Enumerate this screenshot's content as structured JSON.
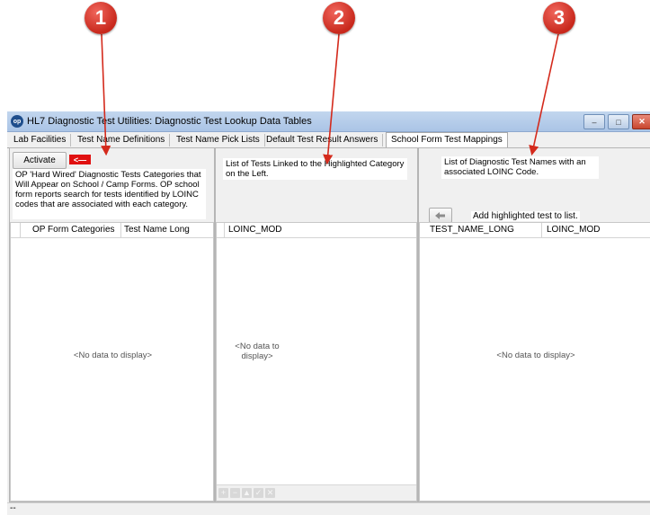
{
  "callouts": [
    "1",
    "2",
    "3"
  ],
  "window": {
    "app_icon": "op",
    "title": "HL7 Diagnostic Test Utilities:  Diagnostic Test Lookup Data Tables",
    "controls": {
      "minimize": "–",
      "maximize": "□",
      "close": "✕"
    }
  },
  "tabs": [
    "Lab Facilities",
    "Test Name Definitions",
    "Test Name Pick Lists",
    "Default Test Result Answers",
    "School Form Test Mappings"
  ],
  "active_tab": "School Form Test Mappings",
  "left_panel": {
    "activate_label": "Activate",
    "red_button_label": "<—",
    "note": "OP 'Hard Wired' Diagnostic Tests Categories that Will Appear on School / Camp Forms. OP school form reports search for tests identified by LOINC codes that are associated with each category.",
    "columns": [
      "OP Form Categories",
      "Test Name Long"
    ],
    "empty_text": "<No data to display>"
  },
  "middle_panel": {
    "note": "List of Tests Linked to the Highlighted Category on the Left.",
    "columns": [
      "LOINC_MOD"
    ],
    "empty_text": "<No data to display>",
    "nav_buttons": [
      "+",
      "−",
      "▲",
      "✓",
      "✕"
    ]
  },
  "right_panel": {
    "note": "List of Diagnostic Test Names with an associated  LOINC Code.",
    "add_icon": "arrow-left-icon",
    "add_label": "Add highlighted test to list.",
    "columns": [
      "TEST_NAME_LONG",
      "LOINC_MOD"
    ],
    "empty_text": "<No data to display>"
  },
  "status_text": "--"
}
